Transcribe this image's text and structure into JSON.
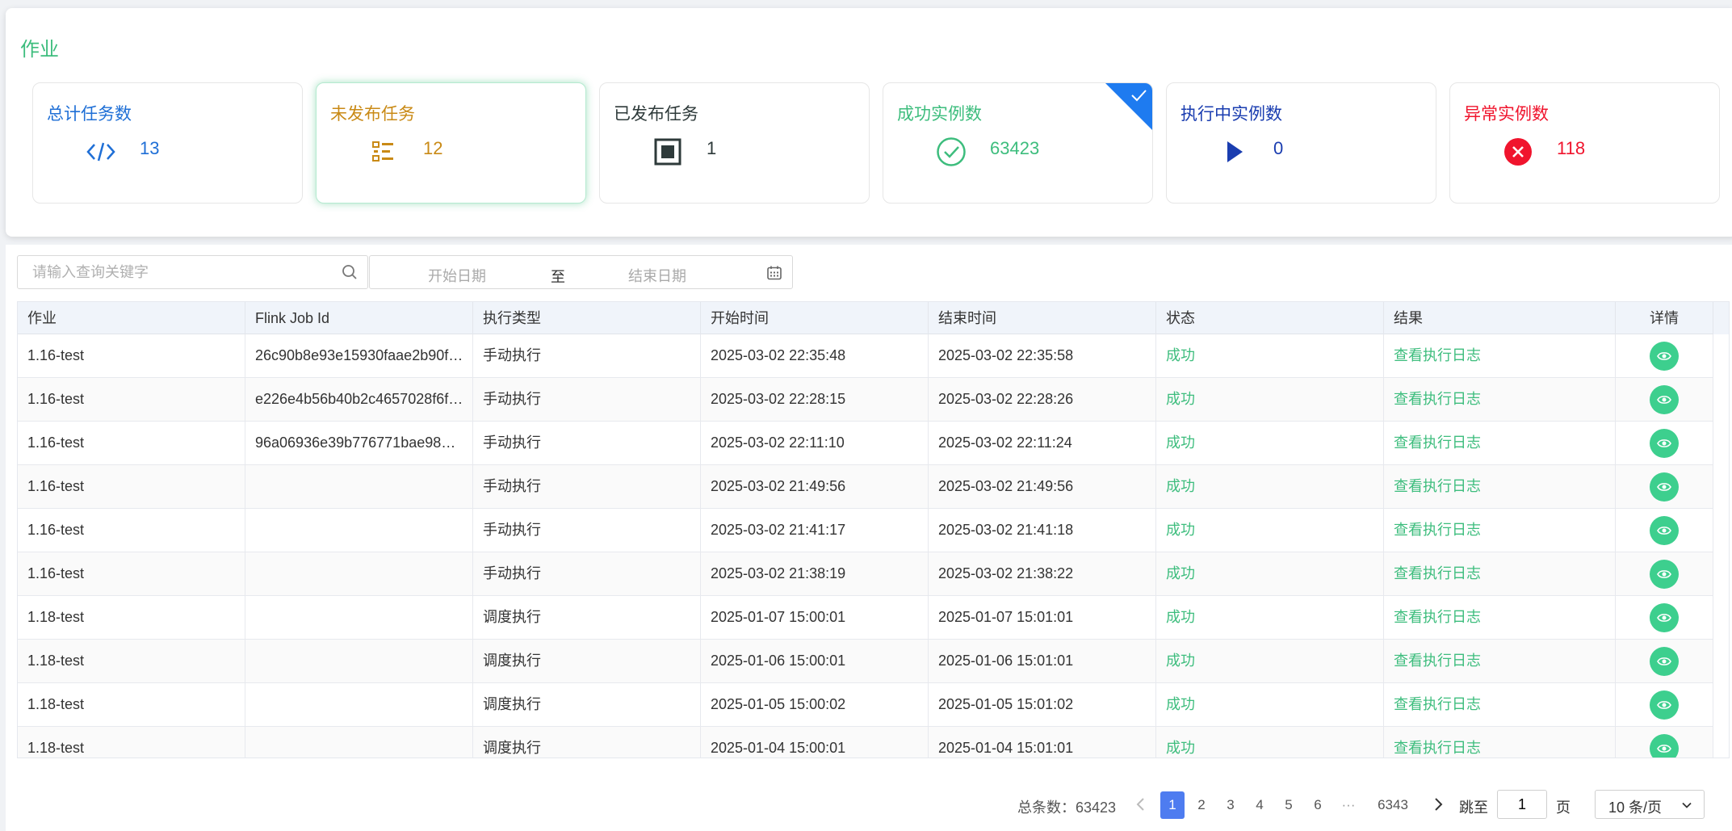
{
  "header": {
    "title": "作业"
  },
  "cards": [
    {
      "label": "总计任务数",
      "value": "13",
      "icon": "code-icon",
      "color": "#1f6fd6"
    },
    {
      "label": "未发布任务",
      "value": "12",
      "icon": "list-icon",
      "color": "#c98a16",
      "active": true
    },
    {
      "label": "已发布任务",
      "value": "1",
      "icon": "stop-square-icon",
      "color": "#2e3a3a"
    },
    {
      "label": "成功实例数",
      "value": "63423",
      "icon": "check-circle-icon",
      "color": "#3dbd7d",
      "selected": true
    },
    {
      "label": "执行中实例数",
      "value": "0",
      "icon": "play-icon",
      "color": "#1a3db0"
    },
    {
      "label": "异常实例数",
      "value": "118",
      "icon": "error-circle-icon",
      "color": "#f0142d"
    }
  ],
  "filters": {
    "search_placeholder": "请输入查询关键字",
    "start_date_placeholder": "开始日期",
    "separator": "至",
    "end_date_placeholder": "结束日期"
  },
  "table": {
    "columns": [
      "作业",
      "Flink Job Id",
      "执行类型",
      "开始时间",
      "结束时间",
      "状态",
      "结果",
      "详情"
    ],
    "rows": [
      {
        "job": "1.16-test",
        "flink_id": "26c90b8e93e15930faae2b90f…",
        "type": "手动执行",
        "start": "2025-03-02 22:35:48",
        "end": "2025-03-02 22:35:58",
        "status": "成功",
        "result": "查看执行日志"
      },
      {
        "job": "1.16-test",
        "flink_id": "e226e4b56b40b2c4657028f6f…",
        "type": "手动执行",
        "start": "2025-03-02 22:28:15",
        "end": "2025-03-02 22:28:26",
        "status": "成功",
        "result": "查看执行日志"
      },
      {
        "job": "1.16-test",
        "flink_id": "96a06936e39b776771bae98…",
        "type": "手动执行",
        "start": "2025-03-02 22:11:10",
        "end": "2025-03-02 22:11:24",
        "status": "成功",
        "result": "查看执行日志"
      },
      {
        "job": "1.16-test",
        "flink_id": "",
        "type": "手动执行",
        "start": "2025-03-02 21:49:56",
        "end": "2025-03-02 21:49:56",
        "status": "成功",
        "result": "查看执行日志"
      },
      {
        "job": "1.16-test",
        "flink_id": "",
        "type": "手动执行",
        "start": "2025-03-02 21:41:17",
        "end": "2025-03-02 21:41:18",
        "status": "成功",
        "result": "查看执行日志"
      },
      {
        "job": "1.16-test",
        "flink_id": "",
        "type": "手动执行",
        "start": "2025-03-02 21:38:19",
        "end": "2025-03-02 21:38:22",
        "status": "成功",
        "result": "查看执行日志"
      },
      {
        "job": "1.18-test",
        "flink_id": "",
        "type": "调度执行",
        "start": "2025-01-07 15:00:01",
        "end": "2025-01-07 15:01:01",
        "status": "成功",
        "result": "查看执行日志"
      },
      {
        "job": "1.18-test",
        "flink_id": "",
        "type": "调度执行",
        "start": "2025-01-06 15:00:01",
        "end": "2025-01-06 15:01:01",
        "status": "成功",
        "result": "查看执行日志"
      },
      {
        "job": "1.18-test",
        "flink_id": "",
        "type": "调度执行",
        "start": "2025-01-05 15:00:02",
        "end": "2025-01-05 15:01:02",
        "status": "成功",
        "result": "查看执行日志"
      },
      {
        "job": "1.18-test",
        "flink_id": "",
        "type": "调度执行",
        "start": "2025-01-04 15:00:01",
        "end": "2025-01-04 15:01:01",
        "status": "成功",
        "result": "查看执行日志"
      }
    ]
  },
  "pagination": {
    "total_label": "总条数：",
    "total": "63423",
    "pages": [
      "1",
      "2",
      "3",
      "4",
      "5",
      "6",
      "···",
      "6343"
    ],
    "current": "1",
    "goto_label": "跳至",
    "goto_value": "1",
    "page_unit": "页",
    "page_size": "10 条/页"
  },
  "colors": {
    "accent": "#3dbd7d",
    "pager_active": "#4e7cf0",
    "corner_badge": "#1e7bf0"
  }
}
